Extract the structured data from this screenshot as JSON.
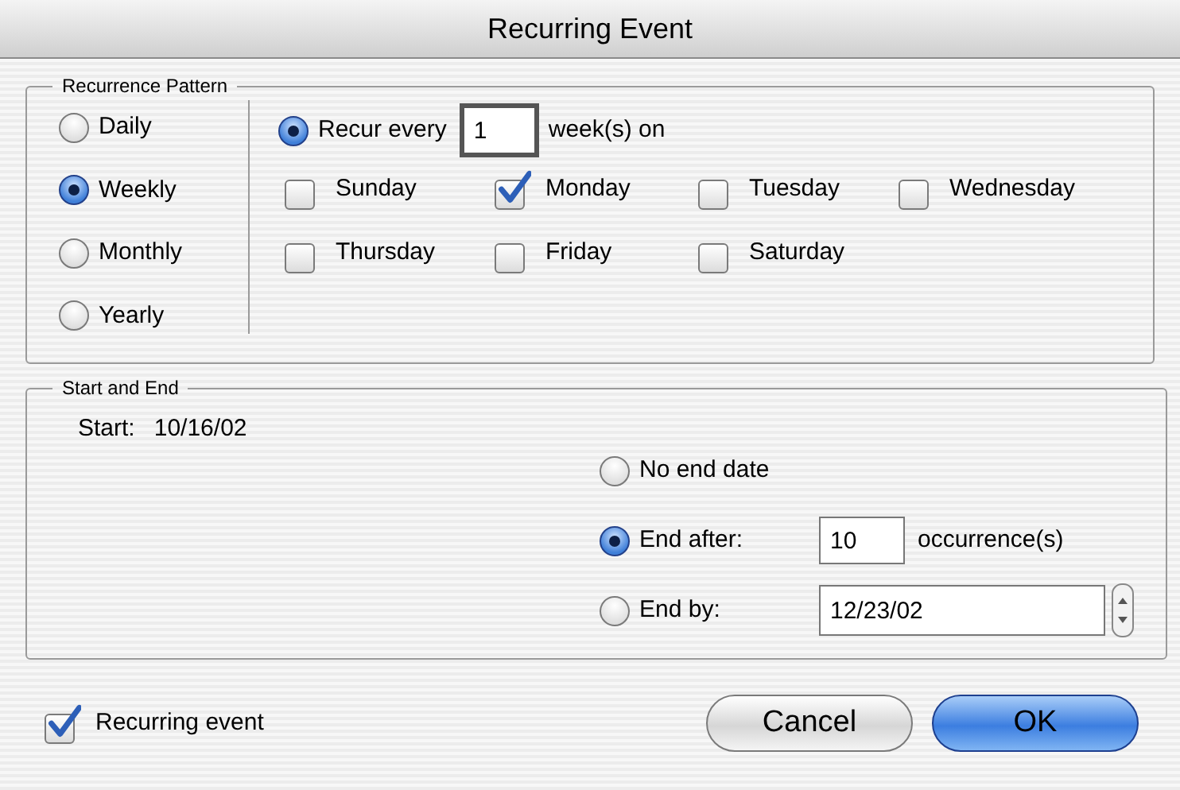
{
  "window": {
    "title": "Recurring Event"
  },
  "recurrence_pattern": {
    "title": "Recurrence Pattern",
    "frequencies": [
      {
        "label": "Daily",
        "selected": false
      },
      {
        "label": "Weekly",
        "selected": true
      },
      {
        "label": "Monthly",
        "selected": false
      },
      {
        "label": "Yearly",
        "selected": false
      }
    ],
    "recur_every": {
      "label": "Recur every",
      "selected": true,
      "value": "1",
      "unit": "week(s) on"
    },
    "days": [
      {
        "label": "Sunday",
        "checked": false
      },
      {
        "label": "Monday",
        "checked": true
      },
      {
        "label": "Tuesday",
        "checked": false
      },
      {
        "label": "Wednesday",
        "checked": false
      },
      {
        "label": "Thursday",
        "checked": false
      },
      {
        "label": "Friday",
        "checked": false
      },
      {
        "label": "Saturday",
        "checked": false
      }
    ]
  },
  "start_and_end": {
    "title": "Start and End",
    "start_label": "Start:",
    "start_value": "10/16/02",
    "end_options": [
      {
        "kind": "none",
        "label": "No end date",
        "selected": false
      },
      {
        "kind": "count",
        "label": "End after:",
        "selected": true,
        "value": "10",
        "unit": "occurrence(s)"
      },
      {
        "kind": "date",
        "label": "End by:",
        "selected": false,
        "value": "12/23/02"
      }
    ]
  },
  "recurring_event": {
    "label": "Recurring event",
    "checked": true
  },
  "buttons": [
    {
      "label": "Cancel",
      "default": false
    },
    {
      "label": "OK",
      "default": true
    }
  ]
}
